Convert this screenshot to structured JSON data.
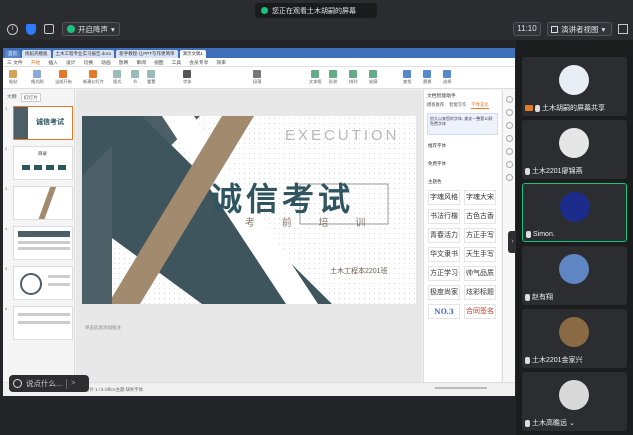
{
  "meeting": {
    "share_notice": "您正在观看土木胡嗣的屏幕",
    "noise_button": "开启降声",
    "time": "11:10",
    "view_button": "演讲者视图",
    "colors": {
      "accent_green": "#19c37d",
      "bar": "#2b2c30",
      "panel": "#1b1c1e"
    }
  },
  "wps": {
    "tabs": [
      {
        "label": "首页"
      },
      {
        "label": "找稻壳模板"
      },
      {
        "label": "土木工程专业实习报告.docx"
      },
      {
        "label": "新手教程-让PPT写作更简单"
      },
      {
        "label": "演示文稿1"
      }
    ],
    "menu": [
      "三 文件",
      "开始",
      "插入",
      "设计",
      "切换",
      "动画",
      "放映",
      "审阅",
      "视图",
      "工具",
      "会员专享",
      "效率"
    ],
    "active_menu": "开始",
    "ribbon": [
      "粘贴",
      "格式刷",
      "当前开始",
      "新建幻灯片",
      "版式",
      "节",
      "重置",
      "字体",
      "段落",
      "文本框",
      "形状",
      "排列",
      "轮廓",
      "查找",
      "替换",
      "选择"
    ],
    "outline_tabs": [
      "大纲",
      "幻灯片"
    ],
    "thumbnails": [
      {
        "num": "1",
        "title": "诚信考试"
      },
      {
        "num": "2",
        "title": "目录"
      },
      {
        "num": "3",
        "title": ""
      },
      {
        "num": "4",
        "title": ""
      },
      {
        "num": "5",
        "title": ""
      },
      {
        "num": "6",
        "title": ""
      }
    ],
    "slide": {
      "title": "诚信考试",
      "subtitle": "考 前 培 训",
      "execution": "EXECUTION",
      "class_label": "土木工程本2201班",
      "colors": {
        "teal": "#2e5560",
        "tan": "#a28a6e",
        "dark": "#4d5f66"
      }
    },
    "notes_placeholder": "单击此处添加备注",
    "right_panel": {
      "title": "文档智能助手",
      "tabs": [
        "模板推荐",
        "智能写作",
        "字体美化"
      ],
      "tip": "很久以来您的字体, 美化一整套30款免费字体",
      "section_1": "推荐字体",
      "section_2": "免费字体",
      "section_3": "主题色",
      "fonts": [
        "字魂风格",
        "字魂大宋",
        "书法行楷",
        "古色古香",
        "青春活力",
        "方正手写",
        "华文隶书",
        "天生手写",
        "方正学习",
        "帅气品质",
        "极度尚家",
        "炫彩标题",
        "NO.3",
        "合同签名"
      ]
    },
    "status": "幻灯片 1 / 6  Office主题  缺失字体",
    "say_placeholder": "说点什么..."
  },
  "participants": [
    {
      "name": "土木胡嗣的屏幕共享",
      "sharing": true
    },
    {
      "name": "土木2201廖锦燕",
      "sharing": false
    },
    {
      "name": "Simon.",
      "sharing": false,
      "active": true
    },
    {
      "name": "赵有翔",
      "sharing": false
    },
    {
      "name": "土木2201金家兴",
      "sharing": false
    },
    {
      "name": "土木高瞻远",
      "sharing": false
    }
  ]
}
